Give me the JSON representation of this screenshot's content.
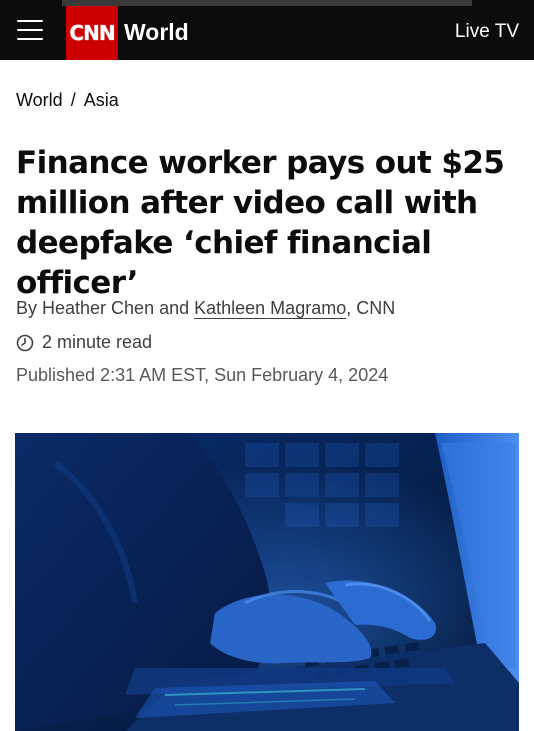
{
  "header": {
    "logo": "CNN",
    "section": "World",
    "live_tv_label": "Live TV",
    "brand_color": "#cc0000",
    "background_color": "#0c0c0c"
  },
  "breadcrumb": {
    "items": [
      "World",
      "Asia"
    ],
    "separator": "/"
  },
  "article": {
    "headline": "Finance worker pays out $25 million after video call with deepfake ‘chief financial officer’",
    "byline_prefix": "By Heather Chen and",
    "author_link": "Kathleen Magramo",
    "byline_suffix": ", CNN",
    "read_time": "2 minute read",
    "published": "Published 2:31 AM EST, Sun February 4, 2024"
  },
  "icons": {
    "menu": "hamburger-menu-icon",
    "clock": "clock-icon"
  },
  "hero_image": {
    "subject": "hands typing on a laptop keyboard in dark blue light",
    "dominant_color": "#0a3a8a"
  }
}
